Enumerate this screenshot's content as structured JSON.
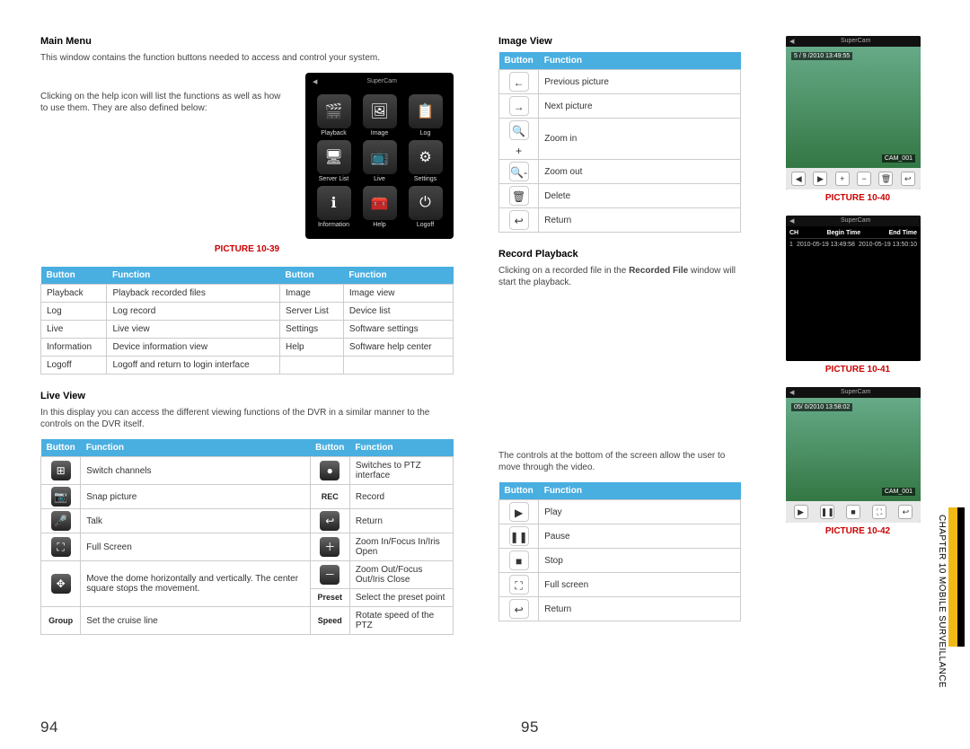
{
  "page": {
    "left_num": "94",
    "right_num": "95",
    "chapter": "CHAPTER 10 MOBILE SURVEILLANCE"
  },
  "mainmenu": {
    "title": "Main Menu",
    "intro": "This window contains the function buttons needed to access and control your system.",
    "help": "Clicking on the help icon will list the functions as well as how to use them. They are also defined below:",
    "caption": "PICTURE 10-39",
    "apps": [
      "Playback",
      "Image",
      "Log",
      "Server List",
      "Live",
      "Settings",
      "Information",
      "Help",
      "Logoff"
    ],
    "table": {
      "hdr": [
        "Button",
        "Function",
        "Button",
        "Function"
      ],
      "rows": [
        [
          "Playback",
          "Playback recorded files",
          "Image",
          "Image view"
        ],
        [
          "Log",
          "Log record",
          "Server List",
          "Device list"
        ],
        [
          "Live",
          "Live view",
          "Settings",
          "Software settings"
        ],
        [
          "Information",
          "Device information view",
          "Help",
          "Software help center"
        ],
        [
          "Logoff",
          "Logoff and return to login interface",
          "",
          ""
        ]
      ]
    }
  },
  "liveview": {
    "title": "Live View",
    "intro": "In this display you can access the different viewing functions of the DVR in a similar manner to the controls on the DVR itself.",
    "table": {
      "hdr": [
        "Button",
        "Function",
        "Button",
        "Function"
      ],
      "rows": [
        {
          "i1": "⊞",
          "f1": "Switch channels",
          "i2": "●",
          "f2": "Switches to PTZ interface"
        },
        {
          "i1": "📷",
          "f1": "Snap picture",
          "i2": "REC",
          "f2": "Record",
          "i2txt": true
        },
        {
          "i1": "🎤",
          "f1": "Talk",
          "i2": "↩",
          "f2": "Return"
        },
        {
          "i1": "⛶",
          "f1": "Full Screen",
          "i2": "＋",
          "f2": "Zoom In/Focus In/Iris Open"
        },
        {
          "i1": "✥",
          "f1": "Move the dome horizontally and vertically. The center square stops the movement.",
          "i2": "－",
          "f2": "Zoom Out/Focus Out/Iris Close"
        },
        {
          "i1": "Group",
          "f1": "Set the cruise line",
          "i2": "Preset",
          "f2": "Select the preset point",
          "i1txt": true,
          "i2txt": true
        },
        {
          "i1": "",
          "f1": "",
          "i2": "Speed",
          "f2": "Rotate speed of the PTZ",
          "i2txt": true,
          "hidefirst": true
        }
      ]
    }
  },
  "imageview": {
    "title": "Image View",
    "table": {
      "hdr": [
        "Button",
        "Function"
      ],
      "rows": [
        {
          "i": "←",
          "f": "Previous picture"
        },
        {
          "i": "→",
          "f": "Next picture"
        },
        {
          "i": "🔍+",
          "f": "Zoom in"
        },
        {
          "i": "🔍-",
          "f": "Zoom out"
        },
        {
          "i": "🗑",
          "f": "Delete"
        },
        {
          "i": "↩",
          "f": "Return"
        }
      ]
    }
  },
  "record": {
    "title": "Record Playback",
    "p1a": "Clicking on a recorded file in the ",
    "p1b": "Recorded File",
    "p1c": " window will start the playback.",
    "p2": "The controls at the bottom of the screen allow the user to move through the video.",
    "table": {
      "hdr": [
        "Button",
        "Function"
      ],
      "rows": [
        {
          "i": "▶",
          "f": "Play"
        },
        {
          "i": "❚❚",
          "f": "Pause"
        },
        {
          "i": "■",
          "f": "Stop"
        },
        {
          "i": "⛶",
          "f": "Full screen"
        },
        {
          "i": "↩",
          "f": "Return"
        }
      ]
    }
  },
  "shots": {
    "app": "SuperCam",
    "s40": {
      "caption": "PICTURE 10-40",
      "ts": "5 / 9 /2010  13:49:55",
      "cam": "CAM_001"
    },
    "s41": {
      "caption": "PICTURE 10-41",
      "hdr": [
        "CH",
        "Begin Time",
        "End Time"
      ],
      "row": [
        "1",
        "2010-05-19 13:49:58",
        "2010-05-19 13:50:10"
      ]
    },
    "s42": {
      "caption": "PICTURE 10-42",
      "ts": "05/ 0/2010  13:58:02",
      "cam": "CAM_001"
    }
  }
}
